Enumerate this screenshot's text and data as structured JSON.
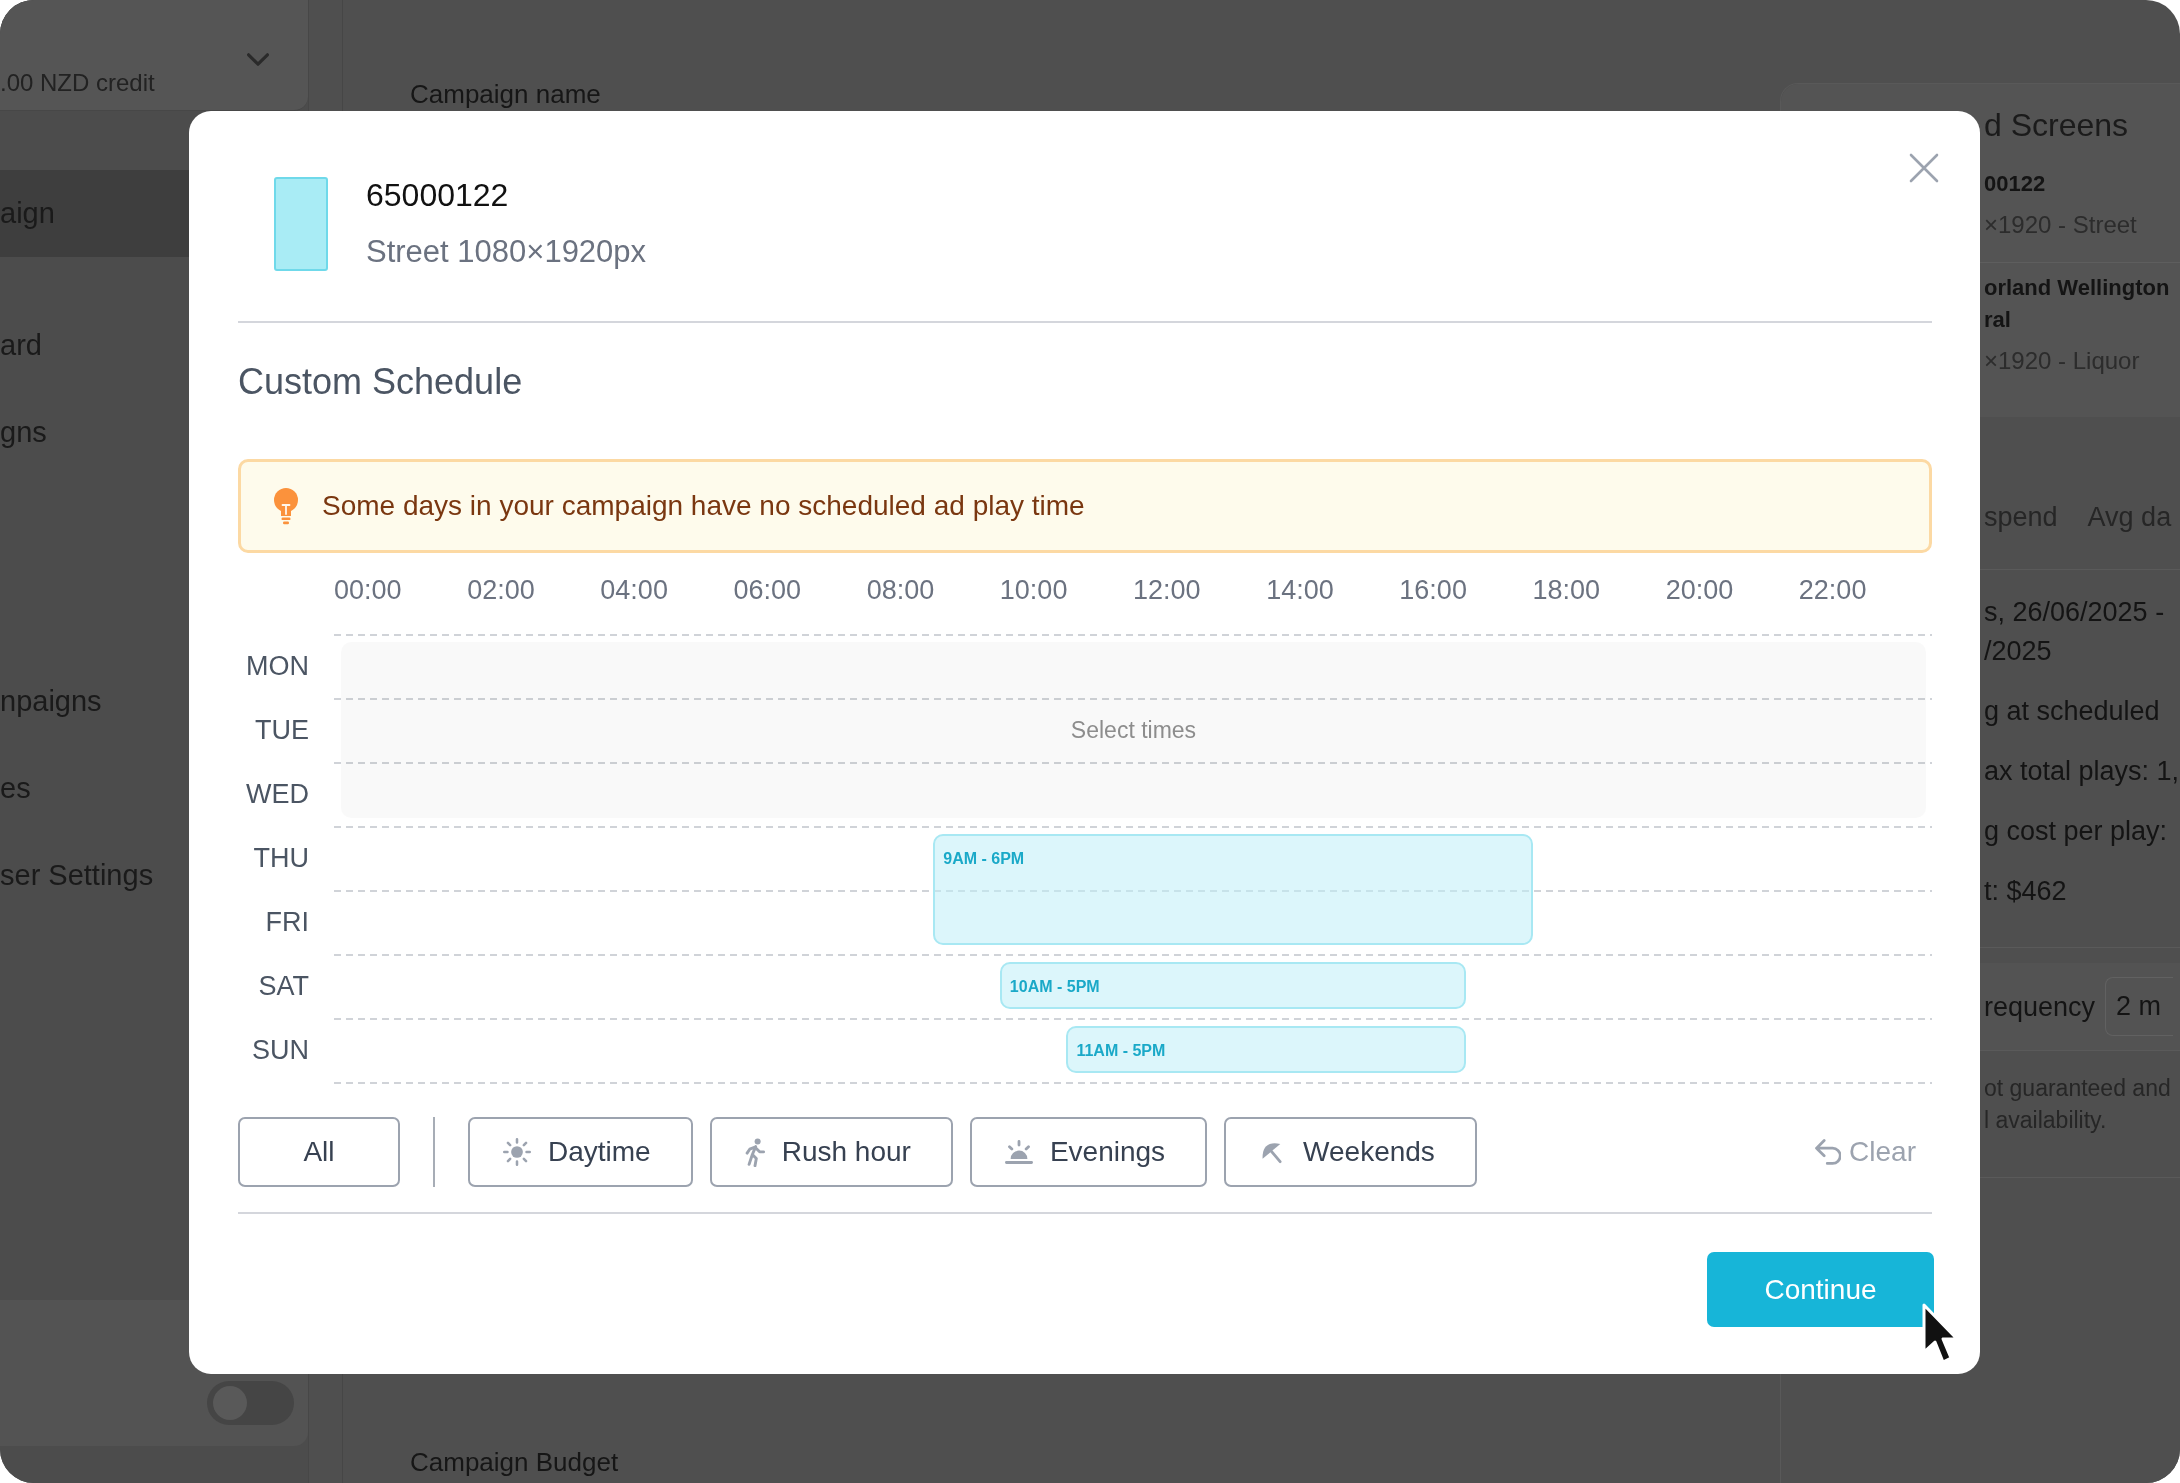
{
  "sidebar": {
    "credit": ".00 NZD credit",
    "sections": [
      {
        "items": [
          {
            "label": "aign",
            "selected": true
          }
        ]
      },
      {
        "items": [
          {
            "label": "ard",
            "selected": false
          },
          {
            "label": "gns",
            "selected": false
          }
        ]
      },
      {
        "items": [
          {
            "label": "npaigns",
            "selected": false
          },
          {
            "label": "es",
            "selected": false
          },
          {
            "label": "ser Settings",
            "selected": false
          }
        ]
      }
    ],
    "toggle": {
      "on": false
    }
  },
  "main": {
    "field_label": "Campaign name",
    "section_title": "Campaign Budget"
  },
  "summary_panel": {
    "title": "d Screens",
    "screens": [
      {
        "name_lines": [
          "00122"
        ],
        "detail": "×1920 - Street"
      },
      {
        "name_lines": [
          "orland Wellington",
          "ral"
        ],
        "detail": "×1920 - Liquor"
      }
    ],
    "stats_headers": [
      "spend",
      "Avg da"
    ],
    "details": [
      [
        "s, 26/06/2025 -",
        "/2025"
      ],
      [
        "g at scheduled"
      ],
      [
        "ax total plays: 1,"
      ],
      [
        "g cost per play:"
      ],
      [
        "t: $462"
      ]
    ],
    "frequency": {
      "label": "requency",
      "value": "2 m"
    },
    "note_lines": [
      "ot guaranteed and",
      "l availability."
    ]
  },
  "modal": {
    "screen": {
      "id": "65000122",
      "format": "Street 1080×1920px"
    },
    "title": "Custom Schedule",
    "alert": "Some days in your campaign have no scheduled ad play time",
    "schedule": {
      "time_labels": [
        "00:00",
        "02:00",
        "04:00",
        "06:00",
        "08:00",
        "10:00",
        "12:00",
        "14:00",
        "16:00",
        "18:00",
        "20:00",
        "22:00"
      ],
      "empty_hint": "Select times",
      "days": [
        {
          "label": "MON"
        },
        {
          "label": "TUE"
        },
        {
          "label": "WED"
        },
        {
          "label": "THU",
          "block": {
            "label": "9AM - 6PM",
            "spans_next_day": true
          }
        },
        {
          "label": "FRI"
        },
        {
          "label": "SAT",
          "block": {
            "label": "10AM - 5PM",
            "spans_next_day": false
          }
        },
        {
          "label": "SUN",
          "block": {
            "label": "11AM - 5PM",
            "spans_next_day": false
          }
        }
      ]
    },
    "presets": [
      {
        "kind": "all",
        "label": "All"
      },
      {
        "kind": "daytime",
        "label": "Daytime"
      },
      {
        "kind": "rush_hour",
        "label": "Rush hour"
      },
      {
        "kind": "evenings",
        "label": "Evenings"
      },
      {
        "kind": "weekends",
        "label": "Weekends"
      }
    ],
    "clear": "Clear",
    "continue": "Continue"
  }
}
